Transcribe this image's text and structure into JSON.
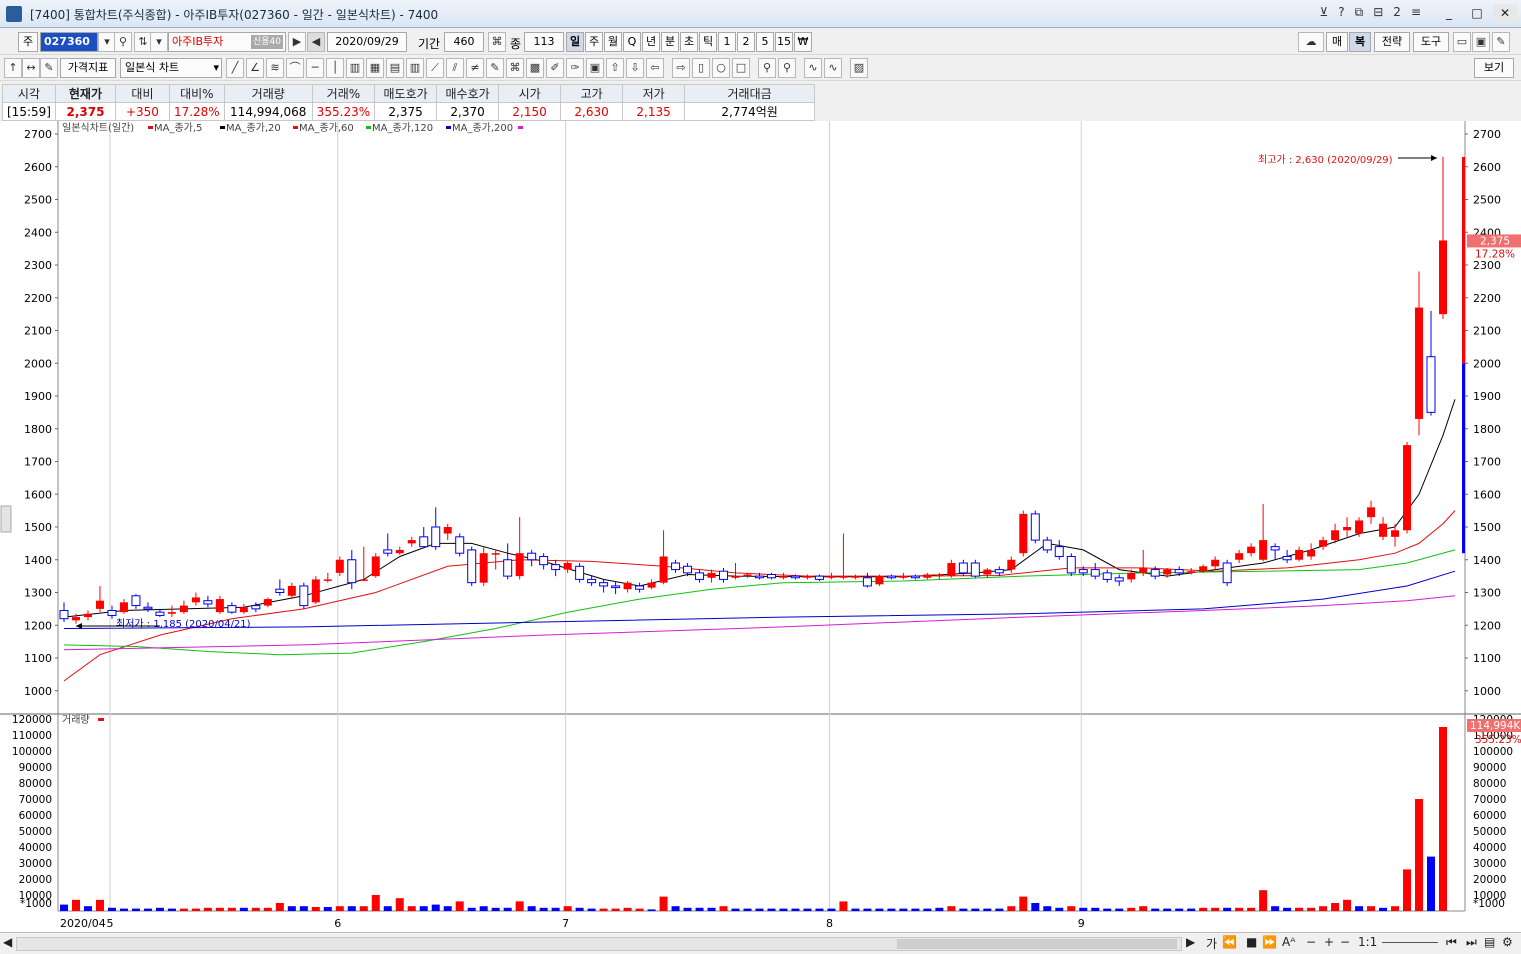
{
  "window": {
    "title": "[7400] 통합차트(주식종합) - 아주IB투자(027360 - 일간 - 일본식차트) - 7400",
    "title_icons": [
      "?",
      "?",
      "2"
    ],
    "buttons": [
      "_",
      "□",
      "✕"
    ]
  },
  "toolbar1": {
    "market_label": "주",
    "code": "027360",
    "name": "아주IB투자",
    "name_badge": "신용40",
    "date": "2020/09/29",
    "period_label": "기간",
    "period_value": "460",
    "count_label": "종",
    "count_value": "113",
    "timeframes": [
      "일",
      "주",
      "월",
      "Q",
      "년",
      "분",
      "초",
      "틱",
      "1",
      "2",
      "5",
      "15",
      "₩"
    ],
    "selected_timeframe": "일",
    "right_buttons": [
      "매",
      "복",
      "전략",
      "도구"
    ]
  },
  "toolbar2": {
    "indicator_button": "가격지표",
    "chart_type": "일본식 차트",
    "view_button": "보기"
  },
  "info": {
    "headers": [
      "시각",
      "현재가",
      "대비",
      "대비%",
      "거래량",
      "거래%",
      "매도호가",
      "매수호가",
      "시가",
      "고가",
      "저가",
      "거래대금"
    ],
    "values": [
      "[15:59]",
      "2,375",
      "+350",
      "17.28%",
      "114,994,068",
      "355.23%",
      "2,375",
      "2,370",
      "2,150",
      "2,630",
      "2,135",
      "2,774억원"
    ]
  },
  "price_panel": {
    "legend": [
      "일본식차트(일간)",
      "MA_종가,5",
      "MA_종가,20",
      "MA_종가,60",
      "MA_종가,120",
      "MA_종가,200"
    ],
    "high_annotation": "최고가 : 2,630 (2020/09/29)",
    "low_annotation": "최저가 : 1,185 (2020/04/21)",
    "current_price_tag": "2,375",
    "current_pct_tag": "17.28%",
    "y_ticks": [
      "2700",
      "2600",
      "2500",
      "2400",
      "2300",
      "2200",
      "2100",
      "2000",
      "1900",
      "1800",
      "1700",
      "1600",
      "1500",
      "1400",
      "1300",
      "1200",
      "1100",
      "1000"
    ]
  },
  "volume_panel": {
    "legend": "거래량",
    "unit": "*1000",
    "current_tag": "114,994K",
    "current_pct_tag": "355.23%",
    "y_ticks": [
      "120000",
      "110000",
      "100000",
      "90000",
      "80000",
      "70000",
      "60000",
      "50000",
      "40000",
      "30000",
      "20000",
      "10000"
    ]
  },
  "x_labels": [
    "2020/04",
    "5",
    "6",
    "7",
    "8",
    "9"
  ],
  "bottom_bar": {
    "zoom": "1:1",
    "label": "가"
  },
  "chart_data": {
    "type": "candlestick",
    "y_range": [
      1000,
      2700
    ],
    "volume_range": [
      0,
      120000
    ],
    "candles": [
      [
        1245,
        1220,
        1270,
        1210
      ],
      [
        1215,
        1225,
        1235,
        1205
      ],
      [
        1225,
        1235,
        1245,
        1215
      ],
      [
        1250,
        1275,
        1320,
        1240
      ],
      [
        1245,
        1230,
        1260,
        1220
      ],
      [
        1240,
        1270,
        1280,
        1235
      ],
      [
        1290,
        1260,
        1295,
        1250
      ],
      [
        1255,
        1250,
        1270,
        1240
      ],
      [
        1240,
        1230,
        1250,
        1225
      ],
      [
        1235,
        1240,
        1260,
        1225
      ],
      [
        1240,
        1260,
        1275,
        1235
      ],
      [
        1270,
        1285,
        1300,
        1260
      ],
      [
        1275,
        1265,
        1290,
        1255
      ],
      [
        1240,
        1280,
        1290,
        1235
      ],
      [
        1260,
        1240,
        1270,
        1235
      ],
      [
        1240,
        1255,
        1265,
        1235
      ],
      [
        1260,
        1250,
        1270,
        1240
      ],
      [
        1260,
        1280,
        1285,
        1255
      ],
      [
        1310,
        1300,
        1340,
        1290
      ],
      [
        1290,
        1320,
        1330,
        1280
      ],
      [
        1320,
        1260,
        1330,
        1250
      ],
      [
        1270,
        1340,
        1350,
        1265
      ],
      [
        1340,
        1340,
        1360,
        1330
      ],
      [
        1360,
        1400,
        1410,
        1350
      ],
      [
        1400,
        1330,
        1430,
        1310
      ],
      [
        1340,
        1340,
        1440,
        1335
      ],
      [
        1350,
        1410,
        1420,
        1345
      ],
      [
        1430,
        1420,
        1480,
        1410
      ],
      [
        1420,
        1430,
        1440,
        1415
      ],
      [
        1450,
        1460,
        1470,
        1440
      ],
      [
        1470,
        1440,
        1500,
        1440
      ],
      [
        1500,
        1440,
        1560,
        1430
      ],
      [
        1480,
        1500,
        1510,
        1460
      ],
      [
        1470,
        1420,
        1480,
        1410
      ],
      [
        1430,
        1330,
        1440,
        1320
      ],
      [
        1330,
        1420,
        1440,
        1320
      ],
      [
        1420,
        1420,
        1430,
        1370
      ],
      [
        1400,
        1350,
        1450,
        1340
      ],
      [
        1350,
        1420,
        1530,
        1340
      ],
      [
        1420,
        1400,
        1430,
        1380
      ],
      [
        1410,
        1385,
        1420,
        1370
      ],
      [
        1385,
        1370,
        1400,
        1350
      ],
      [
        1370,
        1390,
        1395,
        1360
      ],
      [
        1380,
        1340,
        1390,
        1330
      ],
      [
        1340,
        1330,
        1350,
        1320
      ],
      [
        1330,
        1320,
        1340,
        1300
      ],
      [
        1320,
        1315,
        1335,
        1295
      ],
      [
        1310,
        1330,
        1335,
        1300
      ],
      [
        1320,
        1310,
        1330,
        1300
      ],
      [
        1315,
        1330,
        1340,
        1310
      ],
      [
        1330,
        1410,
        1490,
        1325
      ],
      [
        1390,
        1370,
        1400,
        1360
      ],
      [
        1380,
        1360,
        1390,
        1350
      ],
      [
        1360,
        1340,
        1370,
        1330
      ],
      [
        1345,
        1360,
        1370,
        1330
      ],
      [
        1365,
        1340,
        1375,
        1330
      ],
      [
        1345,
        1350,
        1390,
        1340
      ],
      [
        1350,
        1355,
        1360,
        1345
      ],
      [
        1350,
        1345,
        1360,
        1340
      ],
      [
        1355,
        1345,
        1360,
        1340
      ],
      [
        1345,
        1350,
        1360,
        1340
      ],
      [
        1350,
        1345,
        1355,
        1340
      ],
      [
        1345,
        1350,
        1355,
        1340
      ],
      [
        1350,
        1340,
        1355,
        1335
      ],
      [
        1345,
        1350,
        1360,
        1340
      ],
      [
        1345,
        1350,
        1480,
        1340
      ],
      [
        1345,
        1350,
        1355,
        1340
      ],
      [
        1345,
        1320,
        1360,
        1315
      ],
      [
        1325,
        1350,
        1355,
        1320
      ],
      [
        1350,
        1345,
        1355,
        1340
      ],
      [
        1345,
        1350,
        1360,
        1340
      ],
      [
        1350,
        1345,
        1355,
        1340
      ],
      [
        1345,
        1355,
        1360,
        1340
      ],
      [
        1350,
        1355,
        1360,
        1340
      ],
      [
        1350,
        1390,
        1400,
        1345
      ],
      [
        1390,
        1360,
        1400,
        1350
      ],
      [
        1390,
        1350,
        1400,
        1345
      ],
      [
        1355,
        1370,
        1375,
        1345
      ],
      [
        1370,
        1360,
        1380,
        1350
      ],
      [
        1370,
        1400,
        1410,
        1360
      ],
      [
        1420,
        1540,
        1550,
        1410
      ],
      [
        1540,
        1460,
        1550,
        1450
      ],
      [
        1460,
        1430,
        1470,
        1420
      ],
      [
        1440,
        1410,
        1460,
        1400
      ],
      [
        1410,
        1360,
        1420,
        1350
      ],
      [
        1370,
        1360,
        1380,
        1350
      ],
      [
        1370,
        1350,
        1390,
        1340
      ],
      [
        1360,
        1340,
        1370,
        1330
      ],
      [
        1345,
        1335,
        1355,
        1320
      ],
      [
        1340,
        1360,
        1370,
        1330
      ],
      [
        1360,
        1375,
        1430,
        1350
      ],
      [
        1370,
        1350,
        1380,
        1340
      ],
      [
        1355,
        1370,
        1375,
        1345
      ],
      [
        1370,
        1360,
        1380,
        1350
      ],
      [
        1360,
        1365,
        1375,
        1355
      ],
      [
        1365,
        1380,
        1385,
        1360
      ],
      [
        1380,
        1400,
        1410,
        1370
      ],
      [
        1390,
        1330,
        1400,
        1320
      ],
      [
        1400,
        1420,
        1430,
        1390
      ],
      [
        1420,
        1440,
        1450,
        1410
      ],
      [
        1400,
        1460,
        1570,
        1395
      ],
      [
        1440,
        1430,
        1450,
        1400
      ],
      [
        1410,
        1400,
        1430,
        1390
      ],
      [
        1400,
        1430,
        1440,
        1395
      ],
      [
        1410,
        1430,
        1450,
        1400
      ],
      [
        1440,
        1460,
        1470,
        1430
      ],
      [
        1460,
        1490,
        1510,
        1450
      ],
      [
        1490,
        1500,
        1530,
        1470
      ],
      [
        1480,
        1520,
        1530,
        1470
      ],
      [
        1530,
        1560,
        1580,
        1510
      ],
      [
        1470,
        1510,
        1530,
        1460
      ],
      [
        1470,
        1490,
        1510,
        1440
      ],
      [
        1490,
        1750,
        1760,
        1480
      ],
      [
        1830,
        2170,
        2280,
        1780
      ],
      [
        2020,
        1850,
        2160,
        1840
      ],
      [
        2150,
        2375,
        2630,
        2135
      ]
    ],
    "volumes": [
      [
        4000,
        false
      ],
      [
        7000,
        true
      ],
      [
        3000,
        false
      ],
      [
        7000,
        true
      ],
      [
        2000,
        false
      ],
      [
        1500,
        false
      ],
      [
        1500,
        false
      ],
      [
        1500,
        false
      ],
      [
        2000,
        false
      ],
      [
        1500,
        false
      ],
      [
        1500,
        true
      ],
      [
        1500,
        true
      ],
      [
        2000,
        true
      ],
      [
        2000,
        true
      ],
      [
        2000,
        true
      ],
      [
        2000,
        false
      ],
      [
        2000,
        true
      ],
      [
        2000,
        true
      ],
      [
        5000,
        true
      ],
      [
        3000,
        false
      ],
      [
        3000,
        false
      ],
      [
        2500,
        true
      ],
      [
        2500,
        false
      ],
      [
        3000,
        true
      ],
      [
        3000,
        false
      ],
      [
        3000,
        true
      ],
      [
        10000,
        true
      ],
      [
        3000,
        false
      ],
      [
        8000,
        true
      ],
      [
        3000,
        true
      ],
      [
        3000,
        false
      ],
      [
        4000,
        false
      ],
      [
        3000,
        false
      ],
      [
        6000,
        true
      ],
      [
        2000,
        false
      ],
      [
        3000,
        false
      ],
      [
        2000,
        false
      ],
      [
        2000,
        false
      ],
      [
        6000,
        true
      ],
      [
        3000,
        false
      ],
      [
        2000,
        false
      ],
      [
        2000,
        false
      ],
      [
        3000,
        true
      ],
      [
        2000,
        false
      ],
      [
        1500,
        false
      ],
      [
        1500,
        true
      ],
      [
        1500,
        true
      ],
      [
        2000,
        true
      ],
      [
        1500,
        true
      ],
      [
        1000,
        false
      ],
      [
        9000,
        true
      ],
      [
        3000,
        false
      ],
      [
        2000,
        false
      ],
      [
        2000,
        false
      ],
      [
        2000,
        false
      ],
      [
        3000,
        true
      ],
      [
        1500,
        false
      ],
      [
        1500,
        false
      ],
      [
        1500,
        false
      ],
      [
        1500,
        false
      ],
      [
        1500,
        false
      ],
      [
        1500,
        false
      ],
      [
        1500,
        false
      ],
      [
        1500,
        false
      ],
      [
        1500,
        false
      ],
      [
        6000,
        true
      ],
      [
        1500,
        false
      ],
      [
        1500,
        false
      ],
      [
        1500,
        false
      ],
      [
        1500,
        false
      ],
      [
        1500,
        false
      ],
      [
        1500,
        false
      ],
      [
        1500,
        false
      ],
      [
        2000,
        false
      ],
      [
        3000,
        true
      ],
      [
        1500,
        false
      ],
      [
        1500,
        false
      ],
      [
        1500,
        false
      ],
      [
        1500,
        false
      ],
      [
        3000,
        true
      ],
      [
        9000,
        true
      ],
      [
        5000,
        false
      ],
      [
        3000,
        false
      ],
      [
        2000,
        false
      ],
      [
        3000,
        true
      ],
      [
        2000,
        false
      ],
      [
        2000,
        false
      ],
      [
        1500,
        false
      ],
      [
        1500,
        false
      ],
      [
        2000,
        true
      ],
      [
        3000,
        true
      ],
      [
        1500,
        false
      ],
      [
        1500,
        false
      ],
      [
        1500,
        false
      ],
      [
        1500,
        false
      ],
      [
        2000,
        true
      ],
      [
        2000,
        true
      ],
      [
        2000,
        false
      ],
      [
        2000,
        true
      ],
      [
        2000,
        true
      ],
      [
        13000,
        true
      ],
      [
        3000,
        false
      ],
      [
        2000,
        false
      ],
      [
        2000,
        true
      ],
      [
        2000,
        true
      ],
      [
        3000,
        true
      ],
      [
        5000,
        true
      ],
      [
        7000,
        true
      ],
      [
        3000,
        false
      ],
      [
        3000,
        true
      ],
      [
        2000,
        false
      ],
      [
        3000,
        true
      ],
      [
        26000,
        true
      ],
      [
        70000,
        true
      ],
      [
        34000,
        false
      ],
      [
        115000,
        true
      ]
    ],
    "ma5": [
      [
        0,
        1225
      ],
      [
        5,
        1245
      ],
      [
        10,
        1250
      ],
      [
        15,
        1255
      ],
      [
        20,
        1290
      ],
      [
        25,
        1340
      ],
      [
        28,
        1410
      ],
      [
        31,
        1450
      ],
      [
        34,
        1450
      ],
      [
        37,
        1420
      ],
      [
        40,
        1395
      ],
      [
        45,
        1340
      ],
      [
        48,
        1320
      ],
      [
        52,
        1355
      ],
      [
        56,
        1350
      ],
      [
        62,
        1348
      ],
      [
        70,
        1348
      ],
      [
        76,
        1360
      ],
      [
        79,
        1370
      ],
      [
        82,
        1450
      ],
      [
        85,
        1430
      ],
      [
        88,
        1370
      ],
      [
        92,
        1350
      ],
      [
        96,
        1370
      ],
      [
        100,
        1390
      ],
      [
        104,
        1430
      ],
      [
        108,
        1480
      ],
      [
        111,
        1500
      ],
      [
        113,
        1600
      ],
      [
        115,
        1780
      ],
      [
        116,
        1890
      ]
    ],
    "ma20": [
      [
        0,
        1030
      ],
      [
        3,
        1110
      ],
      [
        8,
        1170
      ],
      [
        14,
        1220
      ],
      [
        20,
        1250
      ],
      [
        26,
        1300
      ],
      [
        32,
        1380
      ],
      [
        38,
        1400
      ],
      [
        44,
        1395
      ],
      [
        50,
        1380
      ],
      [
        56,
        1360
      ],
      [
        62,
        1350
      ],
      [
        70,
        1350
      ],
      [
        78,
        1352
      ],
      [
        84,
        1375
      ],
      [
        90,
        1375
      ],
      [
        96,
        1365
      ],
      [
        102,
        1375
      ],
      [
        108,
        1400
      ],
      [
        111,
        1420
      ],
      [
        113,
        1450
      ],
      [
        115,
        1510
      ],
      [
        116,
        1550
      ]
    ],
    "ma60": [
      [
        0,
        1140
      ],
      [
        6,
        1135
      ],
      [
        12,
        1120
      ],
      [
        18,
        1110
      ],
      [
        24,
        1115
      ],
      [
        30,
        1150
      ],
      [
        36,
        1190
      ],
      [
        42,
        1240
      ],
      [
        48,
        1280
      ],
      [
        54,
        1310
      ],
      [
        60,
        1330
      ],
      [
        70,
        1335
      ],
      [
        80,
        1350
      ],
      [
        90,
        1360
      ],
      [
        100,
        1365
      ],
      [
        108,
        1370
      ],
      [
        112,
        1390
      ],
      [
        116,
        1430
      ]
    ],
    "ma120": [
      [
        0,
        1190
      ],
      [
        20,
        1195
      ],
      [
        40,
        1210
      ],
      [
        60,
        1225
      ],
      [
        80,
        1235
      ],
      [
        95,
        1250
      ],
      [
        105,
        1280
      ],
      [
        112,
        1320
      ],
      [
        116,
        1365
      ]
    ],
    "ma200": [
      [
        0,
        1125
      ],
      [
        20,
        1140
      ],
      [
        40,
        1170
      ],
      [
        60,
        1195
      ],
      [
        80,
        1225
      ],
      [
        95,
        1245
      ],
      [
        105,
        1260
      ],
      [
        112,
        1275
      ],
      [
        116,
        1290
      ]
    ]
  }
}
